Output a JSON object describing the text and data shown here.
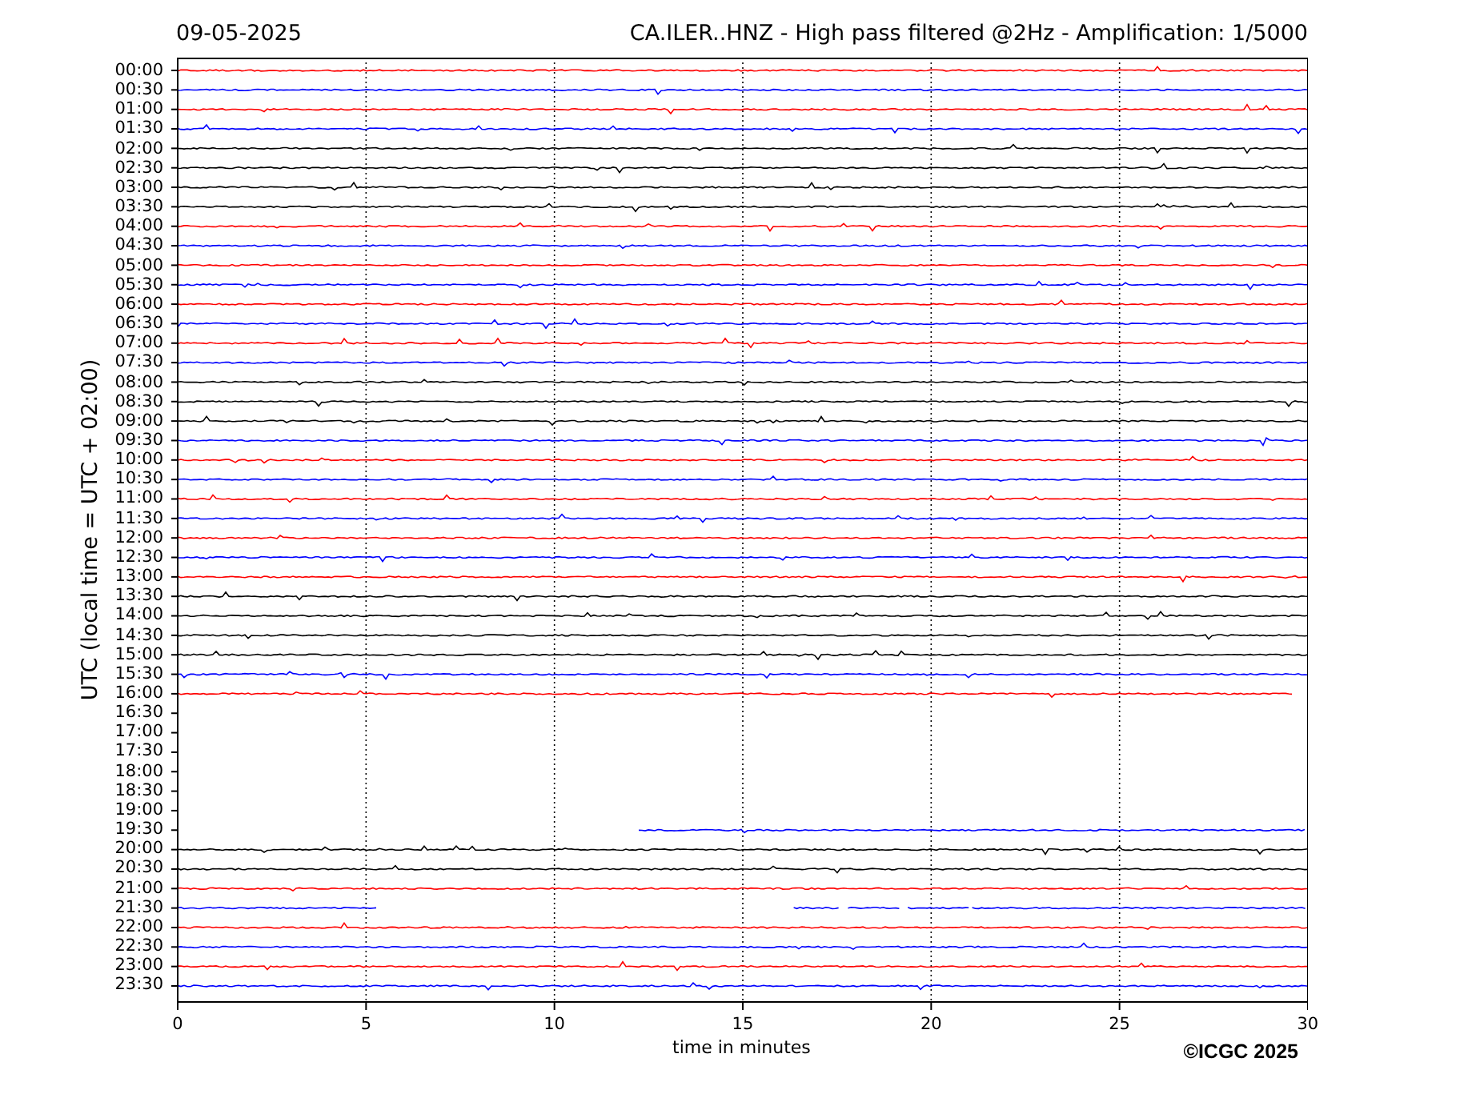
{
  "header": {
    "date": "09-05-2025",
    "title": "CA.ILER..HNZ - High pass filtered @2Hz - Amplification: 1/5000"
  },
  "y_axis": {
    "label": "UTC (local time = UTC + 02:00)"
  },
  "rows": [
    {
      "label": "00:00",
      "color": "#ff0000",
      "kind": "full"
    },
    {
      "label": "00:30",
      "color": "#0000ff",
      "kind": "full"
    },
    {
      "label": "01:00",
      "color": "#ff0000",
      "kind": "full"
    },
    {
      "label": "01:30",
      "color": "#0000ff",
      "kind": "full"
    },
    {
      "label": "02:00",
      "color": "#000000",
      "kind": "full"
    },
    {
      "label": "02:30",
      "color": "#000000",
      "kind": "full"
    },
    {
      "label": "03:00",
      "color": "#000000",
      "kind": "full"
    },
    {
      "label": "03:30",
      "color": "#000000",
      "kind": "full"
    },
    {
      "label": "04:00",
      "color": "#ff0000",
      "kind": "full"
    },
    {
      "label": "04:30",
      "color": "#0000ff",
      "kind": "full"
    },
    {
      "label": "05:00",
      "color": "#ff0000",
      "kind": "full"
    },
    {
      "label": "05:30",
      "color": "#0000ff",
      "kind": "full"
    },
    {
      "label": "06:00",
      "color": "#ff0000",
      "kind": "full"
    },
    {
      "label": "06:30",
      "color": "#0000ff",
      "kind": "full"
    },
    {
      "label": "07:00",
      "color": "#ff0000",
      "kind": "full"
    },
    {
      "label": "07:30",
      "color": "#0000ff",
      "kind": "full"
    },
    {
      "label": "08:00",
      "color": "#000000",
      "kind": "full"
    },
    {
      "label": "08:30",
      "color": "#000000",
      "kind": "full"
    },
    {
      "label": "09:00",
      "color": "#000000",
      "kind": "full"
    },
    {
      "label": "09:30",
      "color": "#0000ff",
      "kind": "full"
    },
    {
      "label": "10:00",
      "color": "#ff0000",
      "kind": "full"
    },
    {
      "label": "10:30",
      "color": "#0000ff",
      "kind": "full"
    },
    {
      "label": "11:00",
      "color": "#ff0000",
      "kind": "full"
    },
    {
      "label": "11:30",
      "color": "#0000ff",
      "kind": "full"
    },
    {
      "label": "12:00",
      "color": "#ff0000",
      "kind": "full"
    },
    {
      "label": "12:30",
      "color": "#0000ff",
      "kind": "full"
    },
    {
      "label": "13:00",
      "color": "#ff0000",
      "kind": "full"
    },
    {
      "label": "13:30",
      "color": "#000000",
      "kind": "full"
    },
    {
      "label": "14:00",
      "color": "#000000",
      "kind": "full"
    },
    {
      "label": "14:30",
      "color": "#000000",
      "kind": "full"
    },
    {
      "label": "15:00",
      "color": "#000000",
      "kind": "full"
    },
    {
      "label": "15:30",
      "color": "#0000ff",
      "kind": "full"
    },
    {
      "label": "16:00",
      "color": "#ff0000",
      "kind": "ends-early"
    },
    {
      "label": "16:30",
      "kind": "empty"
    },
    {
      "label": "17:00",
      "kind": "empty"
    },
    {
      "label": "17:30",
      "kind": "empty"
    },
    {
      "label": "18:00",
      "kind": "empty"
    },
    {
      "label": "18:30",
      "kind": "empty"
    },
    {
      "label": "19:00",
      "kind": "empty"
    },
    {
      "label": "19:30",
      "color": "#0000ff",
      "kind": "starts-late"
    },
    {
      "label": "20:00",
      "color": "#000000",
      "kind": "full"
    },
    {
      "label": "20:30",
      "color": "#000000",
      "kind": "full"
    },
    {
      "label": "21:00",
      "color": "#ff0000",
      "kind": "full"
    },
    {
      "label": "21:30",
      "color": "#0000ff",
      "kind": "broken"
    },
    {
      "label": "22:00",
      "color": "#ff0000",
      "kind": "full"
    },
    {
      "label": "22:30",
      "color": "#0000ff",
      "kind": "full"
    },
    {
      "label": "23:00",
      "color": "#ff0000",
      "kind": "full"
    },
    {
      "label": "23:30",
      "color": "#0000ff",
      "kind": "full"
    }
  ],
  "x_axis": {
    "label": "time in minutes",
    "ticks": [
      "0",
      "5",
      "10",
      "15",
      "20",
      "25",
      "30"
    ]
  },
  "copyright": "©ICGC 2025"
}
